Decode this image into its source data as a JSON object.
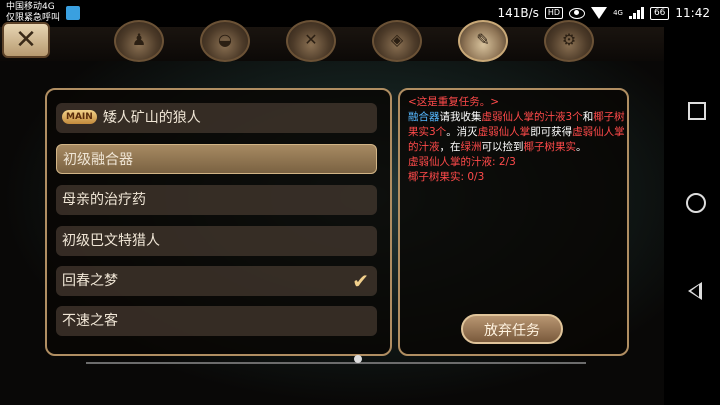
{
  "status_bar": {
    "carrier_line1": "中国移动4G",
    "carrier_line2": "仅限紧急呼叫",
    "speed": "141B/s",
    "hd_badge": "HD",
    "network": "4G",
    "battery": "66",
    "time": "11:42"
  },
  "quests": [
    {
      "label": "矮人矿山的狼人",
      "badge": "MAIN",
      "selected": false,
      "completed": false
    },
    {
      "label": "初级融合器",
      "badge": "",
      "selected": true,
      "completed": false
    },
    {
      "label": "母亲的治疗药",
      "badge": "",
      "selected": false,
      "completed": false
    },
    {
      "label": "初级巴文特猎人",
      "badge": "",
      "selected": false,
      "completed": false
    },
    {
      "label": "回春之梦",
      "badge": "",
      "selected": false,
      "completed": true
    },
    {
      "label": "不速之客",
      "badge": "",
      "selected": false,
      "completed": false
    }
  ],
  "detail": {
    "header": "<这是重复任务。>",
    "p1": "融合器",
    "p2": "请我收集",
    "p3": "虚弱仙人掌的汁液3个",
    "p4": "和",
    "p5": "椰子树果实3个",
    "p6": "。消灭",
    "p7": "虚弱仙人掌",
    "p8": "即可获得",
    "p9": "虚弱仙人掌的汁液",
    "p10": "，在",
    "p11": "绿洲",
    "p12": "可以捡到",
    "p13": "椰子树果实",
    "p14": "。",
    "progress1": "虚弱仙人掌的汁液: 2/3",
    "progress2": "椰子树果实: 0/3"
  },
  "give_up_label": "放弃任务",
  "close_label": "✕",
  "colors": {
    "highlight_red": "#ff4a4a",
    "highlight_blue": "#56b8ff",
    "panel_border": "#b08e62"
  }
}
